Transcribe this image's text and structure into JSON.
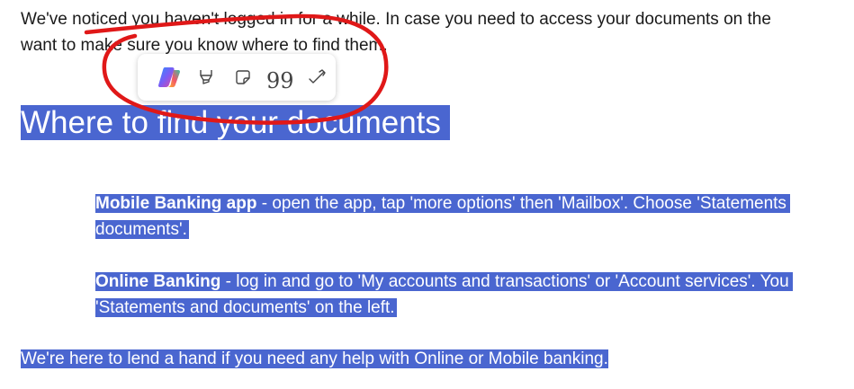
{
  "intro": {
    "line1": "We've noticed you haven't logged in for a while. In case you need to access your documents on the",
    "line2": "want to make sure you know where to find them."
  },
  "heading": "Where to find your documents",
  "paragraphs": [
    {
      "bold": "Mobile Banking app",
      "rest_line1": " - open the app, tap 'more options' then 'Mailbox'. Choose 'Statements",
      "line2": "documents'."
    },
    {
      "bold": "Online Banking",
      "rest_line1": " - log in and go to 'My accounts and transactions' or 'Account services'. You",
      "line2": "'Statements and documents' on the left."
    }
  ],
  "closing": "We're here to lend a hand if you need any help with Online or Mobile banking.",
  "toolbar": {
    "items": [
      {
        "name": "copilot-icon"
      },
      {
        "name": "highlighter-icon"
      },
      {
        "name": "sticky-note-icon"
      },
      {
        "name": "quote-icon",
        "glyph": "99"
      },
      {
        "name": "check-markup-icon"
      }
    ]
  },
  "colors": {
    "selection": "#4a66d0",
    "annotation": "#e01818",
    "text": "#1a1a1a"
  }
}
